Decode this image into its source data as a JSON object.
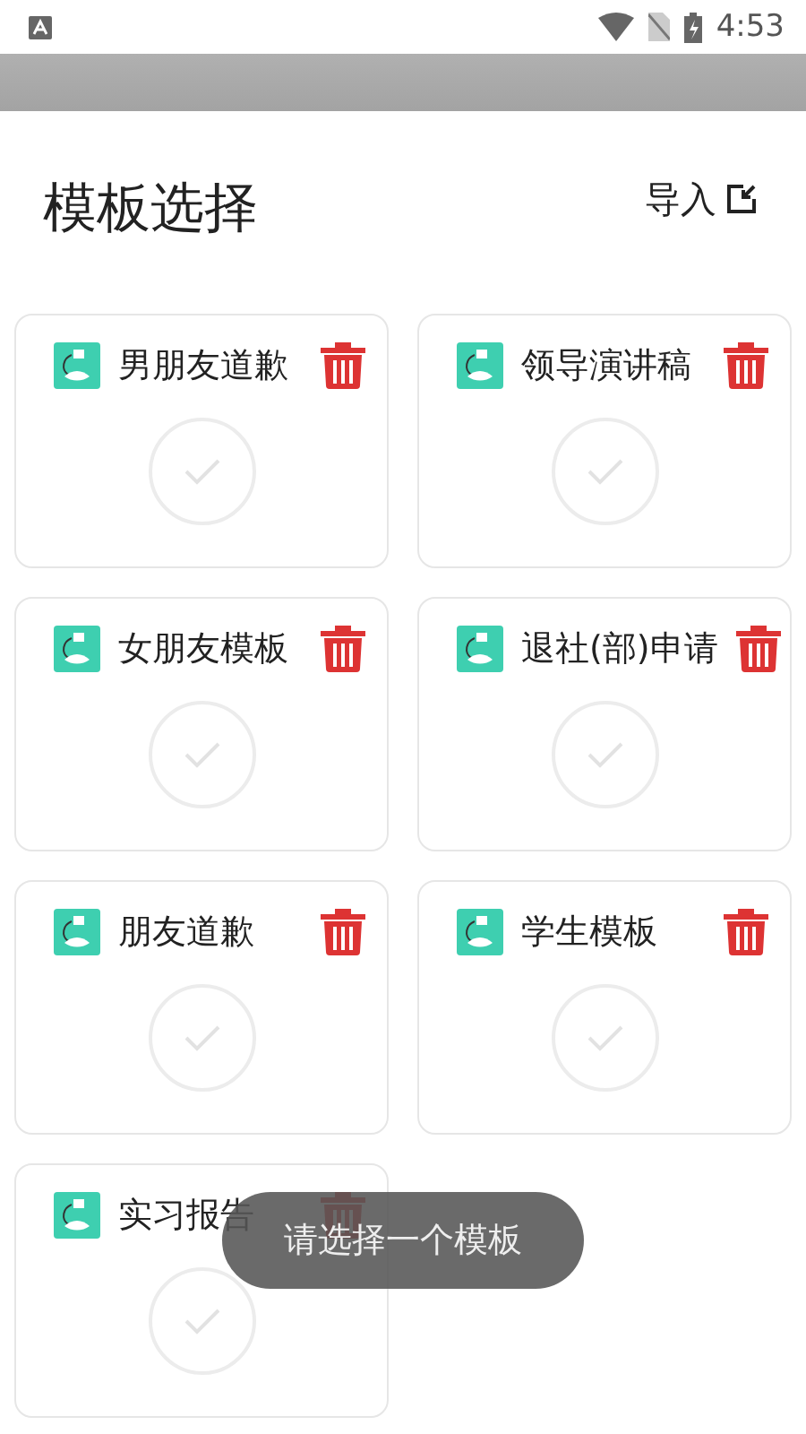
{
  "status_bar": {
    "time": "4:53"
  },
  "header": {
    "title": "模板选择",
    "import_label": "导入"
  },
  "templates": [
    {
      "name": "男朋友道歉",
      "selected": false
    },
    {
      "name": "领导演讲稿",
      "selected": false
    },
    {
      "name": "女朋友模板",
      "selected": false
    },
    {
      "name": "退社(部)申请",
      "selected": false
    },
    {
      "name": "朋友道歉",
      "selected": false
    },
    {
      "name": "学生模板",
      "selected": false
    },
    {
      "name": "实习报告",
      "selected": false
    }
  ],
  "toast": {
    "text": "请选择一个模板"
  }
}
